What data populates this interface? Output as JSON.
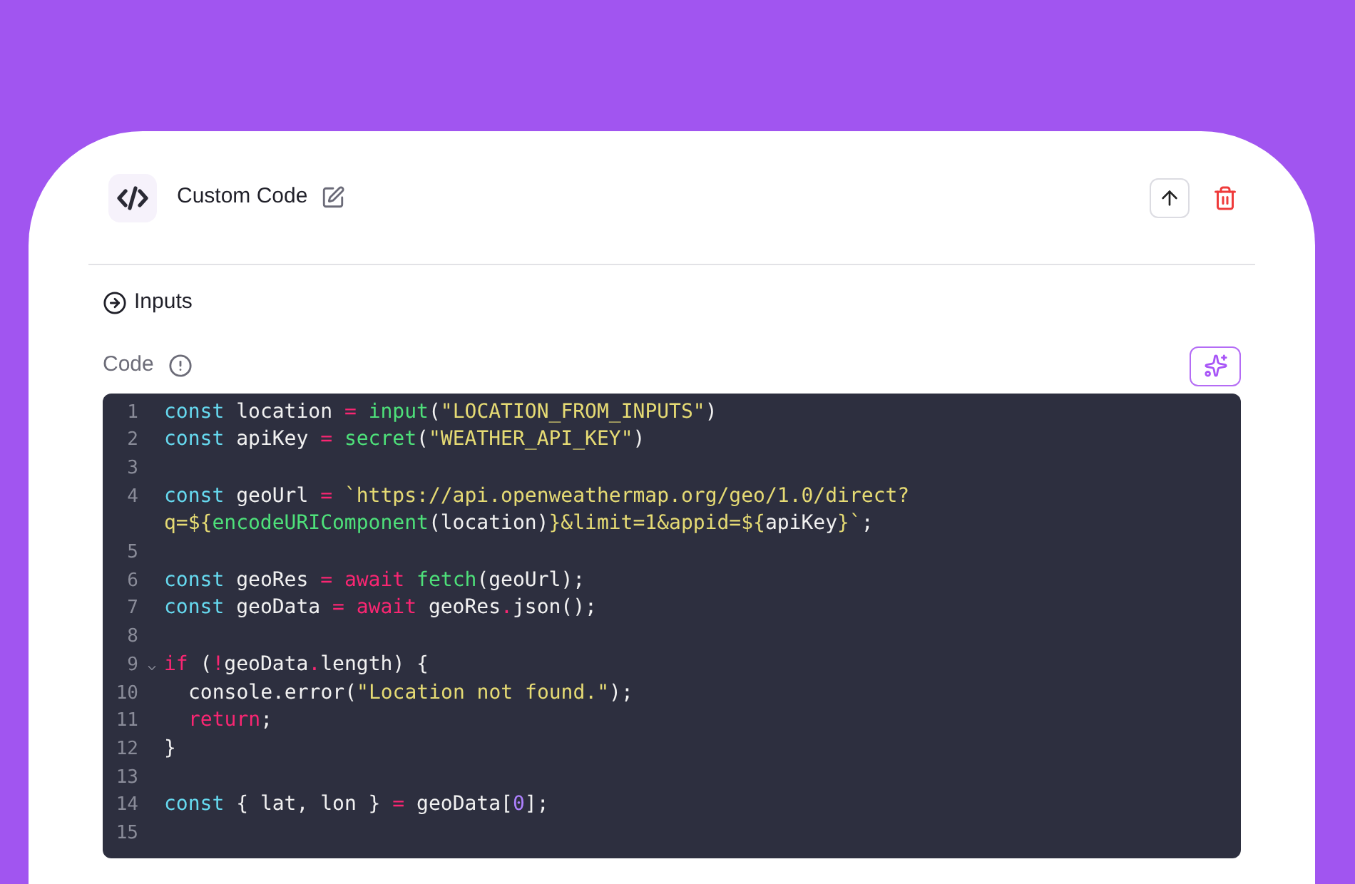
{
  "header": {
    "title": "Custom Code"
  },
  "section": {
    "label": "Inputs"
  },
  "code_field": {
    "label": "Code"
  },
  "editor": {
    "lines": [
      {
        "number": "1",
        "fold": false,
        "tokens": [
          {
            "kind": "keyword",
            "text": "const"
          },
          {
            "kind": "plain",
            "text": " location "
          },
          {
            "kind": "operator",
            "text": "= "
          },
          {
            "kind": "function",
            "text": "input"
          },
          {
            "kind": "plain",
            "text": "("
          },
          {
            "kind": "string",
            "text": "\"LOCATION_FROM_INPUTS\""
          },
          {
            "kind": "plain",
            "text": ")"
          }
        ]
      },
      {
        "number": "2",
        "fold": false,
        "tokens": [
          {
            "kind": "keyword",
            "text": "const"
          },
          {
            "kind": "plain",
            "text": " apiKey "
          },
          {
            "kind": "operator",
            "text": "= "
          },
          {
            "kind": "function",
            "text": "secret"
          },
          {
            "kind": "plain",
            "text": "("
          },
          {
            "kind": "string",
            "text": "\"WEATHER_API_KEY\""
          },
          {
            "kind": "plain",
            "text": ")"
          }
        ]
      },
      {
        "number": "3",
        "fold": false
      },
      {
        "number": "4",
        "fold": false,
        "tokens": [
          {
            "kind": "keyword",
            "text": "const"
          },
          {
            "kind": "plain",
            "text": " geoUrl "
          },
          {
            "kind": "operator",
            "text": "= "
          },
          {
            "kind": "string",
            "text": "`https://api.openweathermap.org/geo/1.0/direct?"
          }
        ]
      },
      {
        "fold": false,
        "tokens": [
          {
            "kind": "string",
            "text": "q=${"
          },
          {
            "kind": "function",
            "text": "encodeURIComponent"
          },
          {
            "kind": "plain",
            "text": "(location)"
          },
          {
            "kind": "string",
            "text": "}&limit=1&appid=${"
          },
          {
            "kind": "plain",
            "text": "apiKey"
          },
          {
            "kind": "string",
            "text": "}`"
          },
          {
            "kind": "plain",
            "text": ";"
          }
        ]
      },
      {
        "number": "5",
        "fold": false
      },
      {
        "number": "6",
        "fold": false,
        "tokens": [
          {
            "kind": "keyword",
            "text": "const"
          },
          {
            "kind": "plain",
            "text": " geoRes "
          },
          {
            "kind": "operator",
            "text": "= await "
          },
          {
            "kind": "function",
            "text": "fetch"
          },
          {
            "kind": "plain",
            "text": "(geoUrl);"
          }
        ]
      },
      {
        "number": "7",
        "fold": false,
        "tokens": [
          {
            "kind": "keyword",
            "text": "const"
          },
          {
            "kind": "plain",
            "text": " geoData "
          },
          {
            "kind": "operator",
            "text": "= await "
          },
          {
            "kind": "plain",
            "text": "geoRes"
          },
          {
            "kind": "operator",
            "text": "."
          },
          {
            "kind": "plain",
            "text": "json();"
          }
        ]
      },
      {
        "number": "8",
        "fold": false
      },
      {
        "number": "9",
        "fold": true,
        "tokens": [
          {
            "kind": "operator",
            "text": "if "
          },
          {
            "kind": "plain",
            "text": "("
          },
          {
            "kind": "operator",
            "text": "!"
          },
          {
            "kind": "plain",
            "text": "geoData"
          },
          {
            "kind": "operator",
            "text": "."
          },
          {
            "kind": "plain",
            "text": "length) {"
          }
        ]
      },
      {
        "number": "10",
        "fold": false,
        "indented": true,
        "tokens": [
          {
            "kind": "plain",
            "text": "console.error("
          },
          {
            "kind": "string",
            "text": "\"Location not found.\""
          },
          {
            "kind": "plain",
            "text": ");"
          }
        ]
      },
      {
        "number": "11",
        "fold": false,
        "indented": true,
        "tokens": [
          {
            "kind": "operator",
            "text": "return"
          },
          {
            "kind": "plain",
            "text": ";"
          }
        ]
      },
      {
        "number": "12",
        "fold": false,
        "tokens": [
          {
            "kind": "plain",
            "text": "}"
          }
        ]
      },
      {
        "number": "13",
        "fold": false
      },
      {
        "number": "14",
        "fold": false,
        "tokens": [
          {
            "kind": "keyword",
            "text": "const"
          },
          {
            "kind": "plain",
            "text": " { lat, lon } "
          },
          {
            "kind": "operator",
            "text": "= "
          },
          {
            "kind": "plain",
            "text": "geoData["
          },
          {
            "kind": "number",
            "text": "0"
          },
          {
            "kind": "plain",
            "text": "];"
          }
        ]
      },
      {
        "number": "15",
        "fold": false
      }
    ]
  }
}
